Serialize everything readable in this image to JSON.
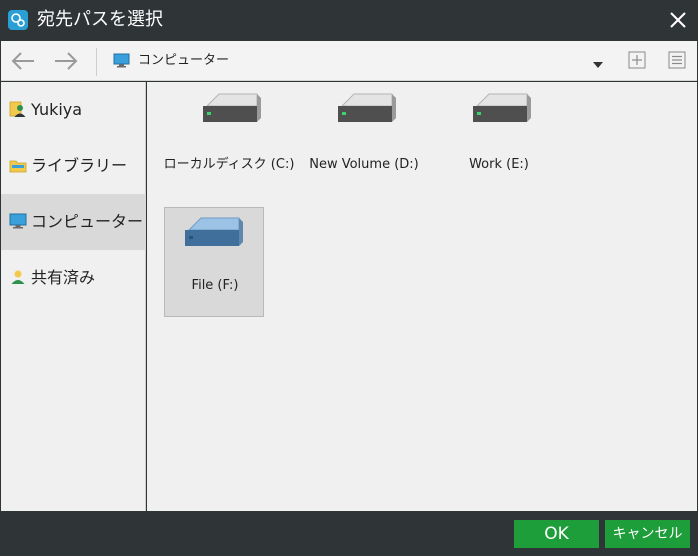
{
  "window": {
    "title": "宛先パスを選択"
  },
  "toolbar": {
    "path_label": "コンピューター"
  },
  "sidebar": {
    "items": [
      {
        "label": "Yukiya",
        "icon": "user-folder-icon",
        "selected": false
      },
      {
        "label": "ライブラリー",
        "icon": "library-folder-icon",
        "selected": false
      },
      {
        "label": "コンピューター",
        "icon": "computer-icon",
        "selected": true
      },
      {
        "label": "共有済み",
        "icon": "shared-user-icon",
        "selected": false
      }
    ]
  },
  "drives": [
    {
      "label": "ローカルディスク (C:)",
      "icon": "hard-drive-icon",
      "selected": false
    },
    {
      "label": "New Volume (D:)",
      "icon": "hard-drive-icon",
      "selected": false
    },
    {
      "label": "Work (E:)",
      "icon": "hard-drive-icon",
      "selected": false
    },
    {
      "label": "File (F:)",
      "icon": "hard-drive-icon",
      "selected": true
    }
  ],
  "footer": {
    "ok_label": "OK",
    "cancel_label": "キャンセル"
  },
  "colors": {
    "titlebar_bg": "#2f3437",
    "accent_green": "#1e9e3a",
    "selection_bg": "#d9d9d9",
    "drive_selected_blue": "#7aa7d1"
  }
}
